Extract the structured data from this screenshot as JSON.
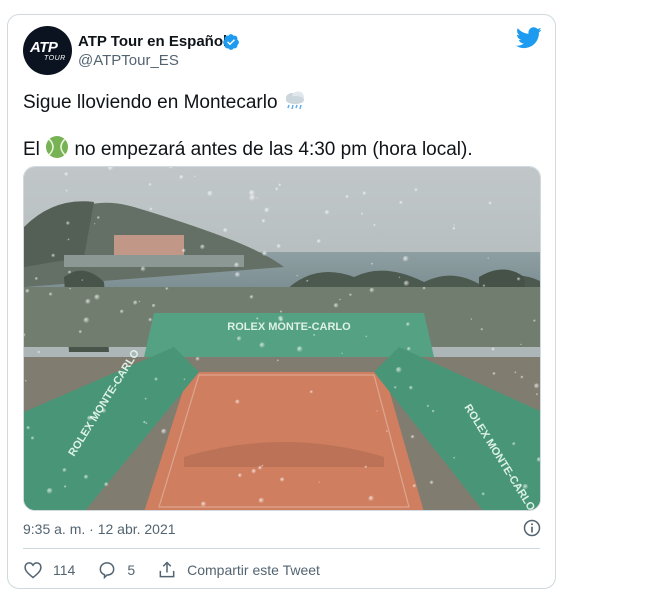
{
  "tweet": {
    "author_name": "ATP Tour en Español",
    "author_handle": "@ATPTour_ES",
    "avatar_logo_main": "ATP",
    "avatar_logo_sub": "TOUR",
    "line1": "Sigue lloviendo en Montecarlo",
    "line2_prefix": "El",
    "line2_suffix": "no empezará antes de las 4:30 pm (hora local).",
    "photo_banner_left": "ROLEX MONTE-CARLO",
    "photo_banner_center": "ROLEX MONTE-CARLO",
    "photo_banner_right": "ROLEX MONTE-CARLO",
    "timestamp": "9:35 a. m. · 12 abr. 2021",
    "likes": "114",
    "replies": "5",
    "share_label": "Compartir este Tweet"
  },
  "icons": {
    "brand": "twitter-bird-icon",
    "verified": "verified-badge-icon",
    "rain": "cloud-with-rain-emoji",
    "ball": "tennis-ball-emoji",
    "info": "info-icon",
    "like": "heart-icon",
    "reply": "reply-bubble-icon",
    "share": "share-icon"
  },
  "colors": {
    "twitter_blue": "#1d9bf0",
    "secondary_text": "#536471",
    "border": "#cfd9de"
  }
}
